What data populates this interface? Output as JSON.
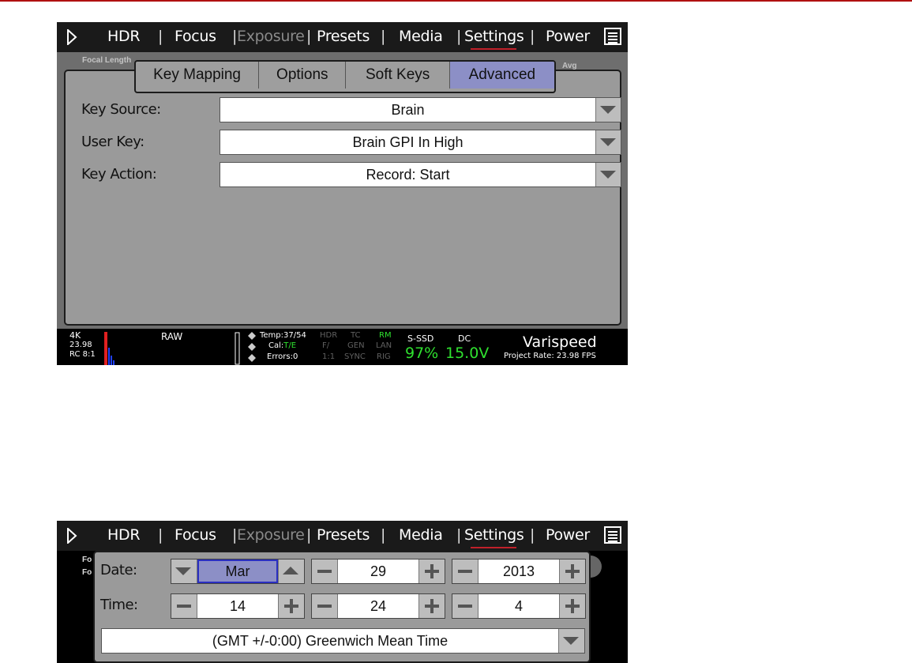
{
  "menu": {
    "hdr": "HDR",
    "focus": "Focus",
    "exposure": "Exposure",
    "presets": "Presets",
    "media": "Media",
    "settings": "Settings",
    "power": "Power",
    "separator": "|"
  },
  "shot1": {
    "background_text": {
      "focal_length": "Focal Length",
      "avg": "Avg"
    },
    "tabs": [
      "Key Mapping",
      "Options",
      "Soft Keys",
      "Advanced"
    ],
    "active_tab": "Advanced",
    "rows": [
      {
        "label": "Key Source:",
        "value": "Brain"
      },
      {
        "label": "User Key:",
        "value": "Brain GPI In High"
      },
      {
        "label": "Key Action:",
        "value": "Record: Start"
      }
    ],
    "status": {
      "resolution": "4K",
      "fps": "23.98",
      "compression": "RC 8:1",
      "raw": "RAW",
      "temp": "Temp:37/54",
      "cal_prefix": "Cal:",
      "cal_value": "T/E",
      "errors": "Errors:0",
      "hdr": "HDR",
      "f": "F/",
      "ratio": "1:1",
      "tc": "TC",
      "gen": "GEN",
      "sync": "SYNC",
      "rm": "RM",
      "lan": "LAN",
      "rig": "RIG",
      "media_label": "S-SSD",
      "media_value": "97%",
      "power_label": "DC",
      "power_value": "15.0V",
      "mode": "Varispeed",
      "project_rate": "Project Rate: 23.98 FPS"
    }
  },
  "shot2": {
    "background_text": "Fo",
    "date_label": "Date:",
    "time_label": "Time:",
    "month": "Mar",
    "day": "29",
    "year": "2013",
    "hour": "14",
    "minute": "24",
    "second": "4",
    "timezone": "(GMT +/-0:00) Greenwich Mean Time"
  },
  "colors": {
    "accent_red": "#c0202a",
    "tab_active": "#8c8fc6",
    "status_green": "#2fe02f",
    "top_rule": "#b01010"
  }
}
